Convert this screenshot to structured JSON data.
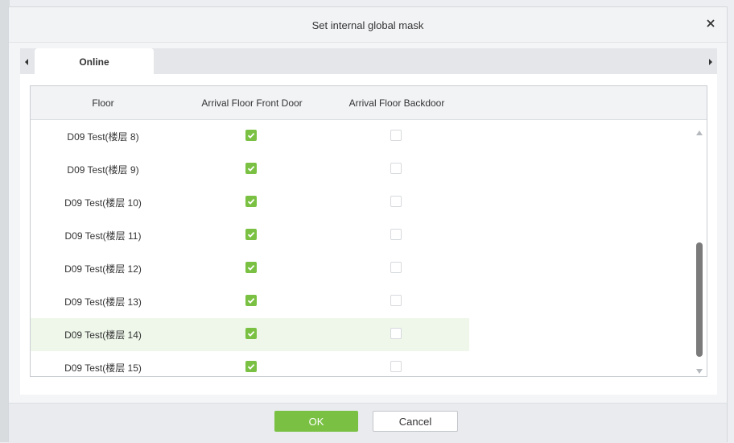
{
  "dialog": {
    "title": "Set internal global mask",
    "close_icon": "close-icon"
  },
  "tabs": [
    {
      "label": "Online",
      "active": true
    }
  ],
  "grid": {
    "columns": [
      "Floor",
      "Arrival Floor Front Door",
      "Arrival Floor Backdoor"
    ],
    "rows": [
      {
        "floor": "D09 Test(楼层 8)",
        "front_door": true,
        "backdoor": false
      },
      {
        "floor": "D09 Test(楼层 9)",
        "front_door": true,
        "backdoor": false
      },
      {
        "floor": "D09 Test(楼层 10)",
        "front_door": true,
        "backdoor": false
      },
      {
        "floor": "D09 Test(楼层 11)",
        "front_door": true,
        "backdoor": false
      },
      {
        "floor": "D09 Test(楼层 12)",
        "front_door": true,
        "backdoor": false
      },
      {
        "floor": "D09 Test(楼层 13)",
        "front_door": true,
        "backdoor": false
      },
      {
        "floor": "D09 Test(楼层 14)",
        "front_door": true,
        "backdoor": false,
        "highlighted": true
      },
      {
        "floor": "D09 Test(楼层 15)",
        "front_door": true,
        "backdoor": false
      }
    ]
  },
  "footer": {
    "ok_label": "OK",
    "cancel_label": "Cancel"
  },
  "colors": {
    "accent": "#7ac143",
    "row_highlight": "#eef7ea"
  }
}
